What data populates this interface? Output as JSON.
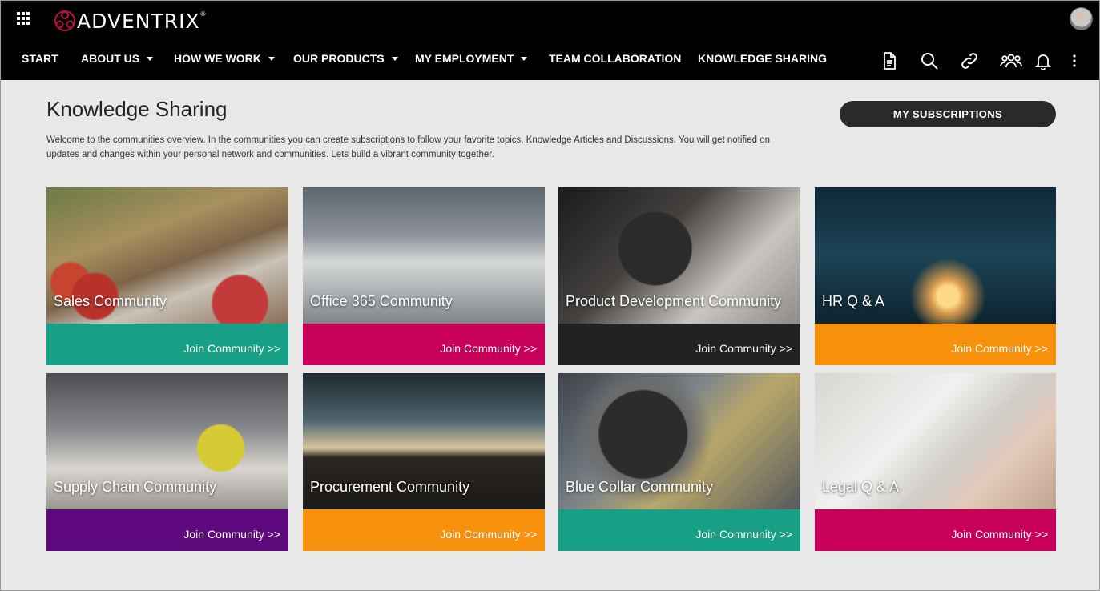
{
  "header": {
    "brand": "ADVENTRIX",
    "brand_mark": "®",
    "nav": [
      {
        "label": "START",
        "dropdown": false
      },
      {
        "label": "ABOUT US",
        "dropdown": true
      },
      {
        "label": "HOW WE WORK",
        "dropdown": true
      },
      {
        "label": "OUR PRODUCTS",
        "dropdown": true
      },
      {
        "label": "MY EMPLOYMENT",
        "dropdown": true
      },
      {
        "label": "TEAM COLLABORATION",
        "dropdown": false
      },
      {
        "label": "KNOWLEDGE SHARING",
        "dropdown": false
      }
    ],
    "tools": [
      "document-icon",
      "search-icon",
      "link-icon",
      "people-icon",
      "bell-icon",
      "more-vertical-icon"
    ]
  },
  "main": {
    "title": "Knowledge Sharing",
    "intro": "Welcome to the communities overview. In the communities you can create subscriptions to follow your favorite topics, Knowledge Articles and Discussions. You will get notified on updates and changes within your personal network and communities. Lets build a vibrant community together.",
    "subscriptions_button": "MY SUBSCRIPTIONS",
    "join_label": "Join Community >>",
    "cards": [
      {
        "name": "Sales Community",
        "color": "#17a085",
        "image": "market-photo"
      },
      {
        "name": "Office 365 Community",
        "color": "#c8005a",
        "image": "city-fog-photo"
      },
      {
        "name": "Product Development Community",
        "color": "#222222",
        "image": "microscope-photo"
      },
      {
        "name": "HR Q & A",
        "color": "#f7900a",
        "image": "reading-man-photo"
      },
      {
        "name": "Supply Chain Community",
        "color": "#5e0a7e",
        "image": "forklift-photo"
      },
      {
        "name": "Procurement Community",
        "color": "#f7900a",
        "image": "sunset-team-photo"
      },
      {
        "name": "Blue Collar Community",
        "color": "#17a085",
        "image": "factory-photo"
      },
      {
        "name": "Legal Q & A",
        "color": "#c8005a",
        "image": "signing-photo"
      }
    ]
  }
}
